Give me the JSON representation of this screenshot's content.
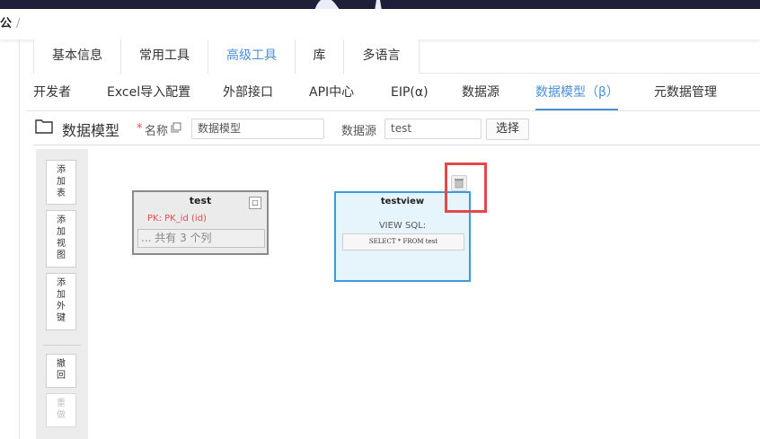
{
  "breadcrumb": {
    "crumb": "公",
    "sep": "/"
  },
  "tabs_main": [
    {
      "label": "基本信息",
      "active": false
    },
    {
      "label": "常用工具",
      "active": false
    },
    {
      "label": "高级工具",
      "active": true
    },
    {
      "label": "库",
      "active": false
    },
    {
      "label": "多语言",
      "active": false
    }
  ],
  "tabs_sub": [
    {
      "label": "开发者",
      "active": false
    },
    {
      "label": "Excel导入配置",
      "active": false
    },
    {
      "label": "外部接口",
      "active": false
    },
    {
      "label": "API中心",
      "active": false
    },
    {
      "label": "EIP(α)",
      "active": false
    },
    {
      "label": "数据源",
      "active": false
    },
    {
      "label": "数据模型（β）",
      "active": true
    },
    {
      "label": "元数据管理",
      "active": false
    }
  ],
  "toolbar": {
    "title": "数据模型",
    "required_mark": "*",
    "name_label": "名称",
    "name_value": "数据模型",
    "datasource_label": "数据源",
    "datasource_value": "test",
    "select_button": "选择"
  },
  "sidebar": {
    "add_table": "添加表",
    "add_view": "添加视图",
    "add_foreign_key": "添加外键",
    "undo": "撤回",
    "redo": "重做"
  },
  "table_node": {
    "title": "test",
    "collapse_symbol": "□",
    "pk_text": "PK: PK_id (id)",
    "columns_summary": "... 共有 3 个列"
  },
  "view_node": {
    "title": "testview",
    "sql_label": "VIEW SQL:",
    "sql": "SELECT * FROM test"
  },
  "colors": {
    "accent": "#4a90d9",
    "highlight": "#e5474d",
    "view_border": "#3c9be0",
    "topbar": "#1f1f3a"
  },
  "icons": {
    "folder": "folder-icon",
    "copy": "copy-icon",
    "trash": "trash-icon"
  }
}
